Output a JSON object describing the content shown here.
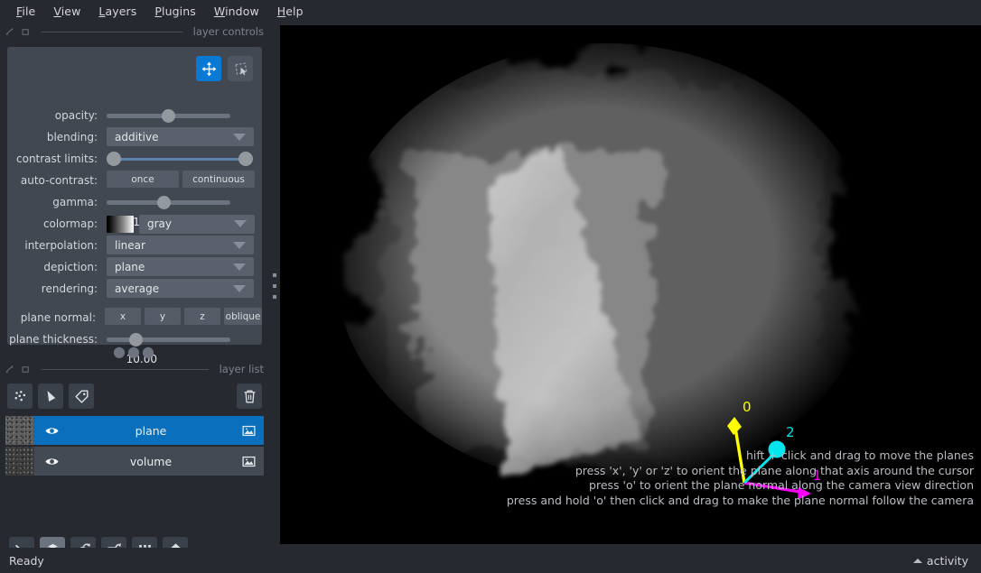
{
  "menu": {
    "items": [
      {
        "label": "File",
        "mnemonic": "F"
      },
      {
        "label": "View",
        "mnemonic": "V"
      },
      {
        "label": "Layers",
        "mnemonic": "L"
      },
      {
        "label": "Plugins",
        "mnemonic": "P"
      },
      {
        "label": "Window",
        "mnemonic": "W"
      },
      {
        "label": "Help",
        "mnemonic": "H"
      }
    ]
  },
  "layer_controls": {
    "dock_title": "layer controls",
    "mode_buttons": [
      {
        "name": "pan-zoom",
        "icon": "move-icon",
        "active": true
      },
      {
        "name": "transform",
        "icon": "transform-icon",
        "active": false
      }
    ],
    "opacity": {
      "label": "opacity:",
      "value": "0.50",
      "fraction": 0.5
    },
    "blending": {
      "label": "blending:",
      "value": "additive"
    },
    "contrast_limits": {
      "label": "contrast limits:",
      "low": 0.0,
      "high": 1.0
    },
    "auto_contrast": {
      "label": "auto-contrast:",
      "once": "once",
      "continuous": "continuous"
    },
    "gamma": {
      "label": "gamma:",
      "value": "1.00",
      "fraction": 0.5
    },
    "colormap": {
      "label": "colormap:",
      "value": "gray"
    },
    "interpolation": {
      "label": "interpolation:",
      "value": "linear"
    },
    "depiction": {
      "label": "depiction:",
      "value": "plane"
    },
    "rendering": {
      "label": "rendering:",
      "value": "average"
    },
    "plane_normal": {
      "label": "plane normal:",
      "options": [
        "x",
        "y",
        "z",
        "oblique"
      ]
    },
    "plane_thickness": {
      "label": "plane thickness:",
      "value": "10.00",
      "fraction": 0.2
    }
  },
  "layer_list": {
    "dock_title": "layer list",
    "add_buttons": [
      {
        "name": "new-points-layer",
        "icon": "points-icon"
      },
      {
        "name": "new-shapes-layer",
        "icon": "shapes-icon"
      },
      {
        "name": "new-labels-layer",
        "icon": "labels-icon"
      }
    ],
    "delete_button": {
      "name": "delete-layer",
      "icon": "trash-icon"
    },
    "layers": [
      {
        "name": "plane",
        "selected": true,
        "visible": true,
        "type_icon": "image-icon"
      },
      {
        "name": "volume",
        "selected": false,
        "visible": true,
        "type_icon": "image-icon"
      }
    ]
  },
  "view_buttons": [
    {
      "name": "console",
      "icon": "console-icon",
      "active": false
    },
    {
      "name": "ndisplay-toggle",
      "icon": "cube-3d-icon",
      "active": true
    },
    {
      "name": "roll-dims",
      "icon": "roll-cube-icon",
      "active": false
    },
    {
      "name": "transpose-dims",
      "icon": "transpose-icon",
      "active": false
    },
    {
      "name": "grid-view",
      "icon": "grid-icon",
      "active": false
    },
    {
      "name": "reset-view",
      "icon": "home-icon",
      "active": false
    }
  ],
  "canvas": {
    "background_color": "#000000",
    "axes": {
      "labels": [
        {
          "text": "0",
          "color": "#ffff00"
        },
        {
          "text": "1",
          "color": "#ff00ff"
        },
        {
          "text": "2",
          "color": "#00d9e0"
        }
      ]
    },
    "overlay_lines": [
      "hift + click and drag to move the planes",
      "press 'x', 'y' or 'z' to orient the plane along that axis around the cursor",
      "press 'o' to orient the plane normal along the camera view direction",
      "press and hold 'o' then click and drag to make the plane normal follow the camera"
    ]
  },
  "status_bar": {
    "status": "Ready",
    "activity": "activity"
  }
}
